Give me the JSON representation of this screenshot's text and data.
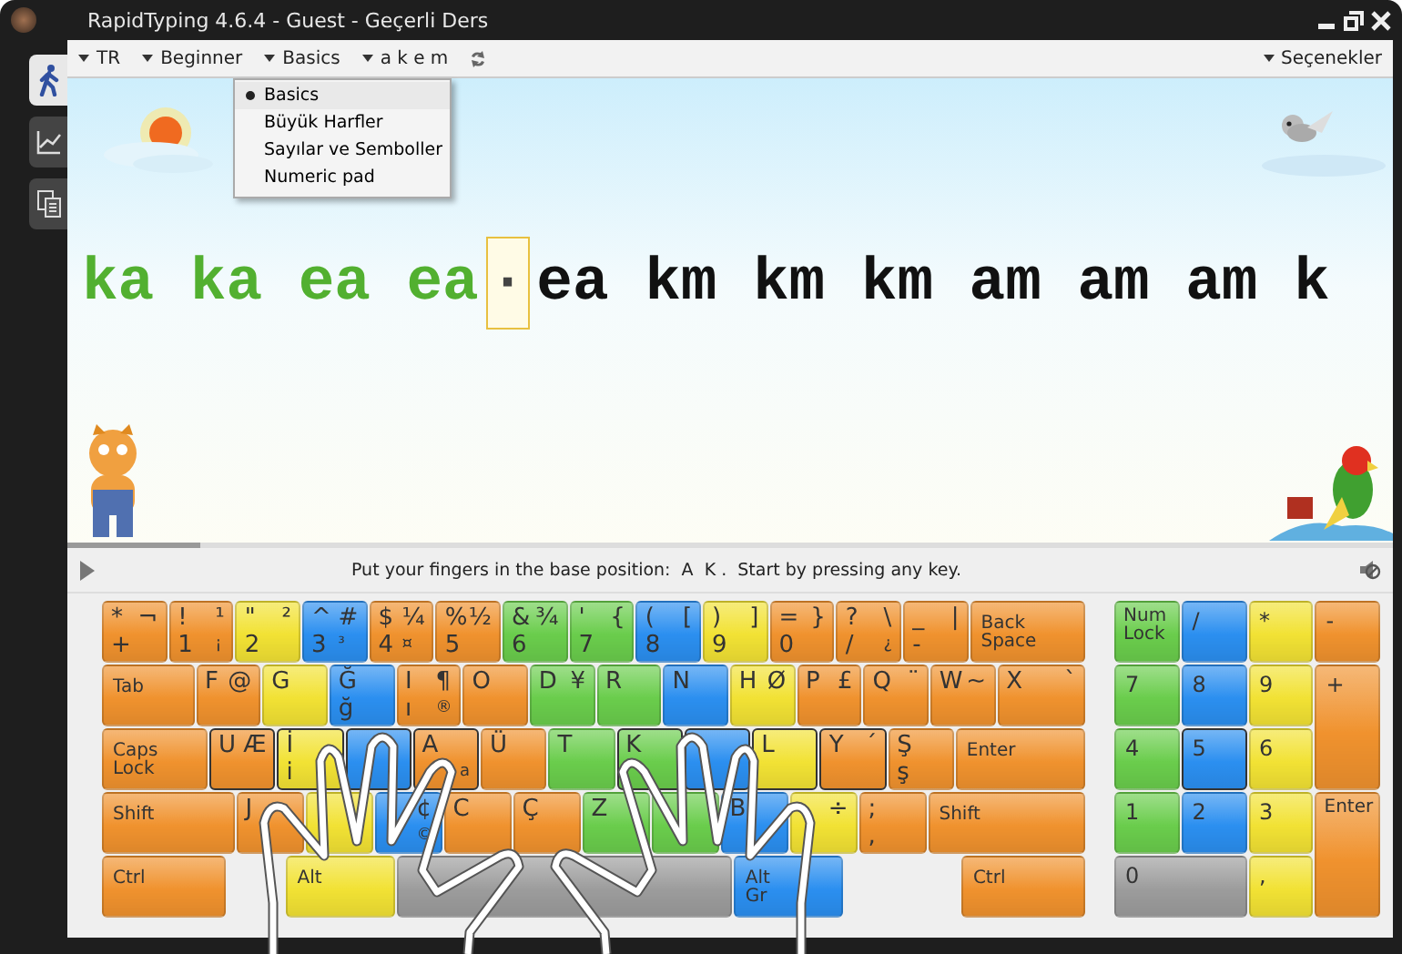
{
  "window": {
    "title": "RapidTyping 4.6.4 - Guest - Geçerli Ders"
  },
  "sidebar": [
    {
      "kind": "walker",
      "selected": true
    },
    {
      "kind": "chart",
      "selected": false
    },
    {
      "kind": "docs",
      "selected": false
    }
  ],
  "menu": [
    {
      "label": "TR"
    },
    {
      "label": "Beginner"
    },
    {
      "label": "Basics"
    },
    {
      "label": "a k e m"
    }
  ],
  "options": {
    "label": "Seçenekler"
  },
  "dropdown": [
    {
      "label": "Basics",
      "selected": true
    },
    {
      "label": "Büyük Harfler",
      "selected": false
    },
    {
      "label": "Sayılar ve Semboller",
      "selected": false
    },
    {
      "label": "Numeric pad",
      "selected": false
    }
  ],
  "lesson": {
    "typed": "ka ka ea ea",
    "cursor": "·",
    "pending": "ea km km km am am am k"
  },
  "progress": {
    "level": 0.1
  },
  "status": {
    "message": "Put your fingers in the base position:  A  K .  Start by pressing any key."
  },
  "keyboard": {
    "rows": [
      {
        "keys": [
          {
            "tl": "*",
            "tr": "¬",
            "bl": "+",
            "color": "#f0922e",
            "home": false
          },
          {
            "tl": "!",
            "tr": "¹",
            "bl": "1",
            "br": "¡",
            "color": "#f0922e",
            "home": false
          },
          {
            "tl": "\"",
            "tr": "²",
            "bl": "2",
            "color": "#f2e234",
            "home": false
          },
          {
            "tl": "^",
            "tr": "#",
            "bl": "3",
            "br": "³",
            "color": "#2b8ff0",
            "home": false
          },
          {
            "tl": "$",
            "tr": "¼",
            "bl": "4",
            "br": "¤",
            "color": "#f0922e",
            "home": false
          },
          {
            "tl": "%",
            "tr": "½",
            "bl": "5",
            "color": "#f0922e",
            "home": false
          },
          {
            "tl": "&",
            "tr": "¾",
            "bl": "6",
            "color": "#6acd4c",
            "home": false
          },
          {
            "tl": "'",
            "tr": "{",
            "bl": "7",
            "color": "#6acd4c",
            "home": false
          },
          {
            "tl": "(",
            "tr": "[",
            "bl": "8",
            "color": "#2b8ff0",
            "home": false
          },
          {
            "tl": ")",
            "tr": "]",
            "bl": "9",
            "color": "#f2e234",
            "home": false
          },
          {
            "tl": "=",
            "tr": "}",
            "bl": "0",
            "color": "#f0922e",
            "home": false
          },
          {
            "tl": "?",
            "tr": "\\",
            "bl": "/",
            "br": "¿",
            "color": "#f0922e",
            "home": false
          },
          {
            "tl": "_",
            "tr": "|",
            "bl": "-",
            "color": "#f0922e",
            "home": false
          },
          {
            "label": "Back Space",
            "color": "#f0922e",
            "home": false
          }
        ]
      },
      {
        "keys": [
          {
            "label": "Tab",
            "color": "#f0922e",
            "home": false
          },
          {
            "tl": "F",
            "tr": "@",
            "color": "#f0922e",
            "home": false
          },
          {
            "tl": "G",
            "color": "#f2e234",
            "home": false
          },
          {
            "tl": "Ğ",
            "bl": "ğ",
            "color": "#2b8ff0",
            "home": false
          },
          {
            "tl": "I",
            "tr": "¶",
            "bl": "ı",
            "br": "®",
            "color": "#f0922e",
            "home": false
          },
          {
            "tl": "O",
            "color": "#f0922e",
            "home": false
          },
          {
            "tl": "D",
            "tr": "¥",
            "color": "#6acd4c",
            "home": false
          },
          {
            "tl": "R",
            "color": "#6acd4c",
            "home": false
          },
          {
            "tl": "N",
            "color": "#2b8ff0",
            "home": false
          },
          {
            "tl": "H",
            "tr": "Ø",
            "color": "#f2e234",
            "home": false
          },
          {
            "tl": "P",
            "tr": "£",
            "color": "#f0922e",
            "home": false
          },
          {
            "tl": "Q",
            "tr": "¨",
            "color": "#f0922e",
            "home": false
          },
          {
            "tl": "W",
            "tr": "~",
            "color": "#f0922e",
            "home": false
          },
          {
            "tl": "X",
            "tr": "`",
            "color": "#f0922e",
            "home": false
          }
        ]
      },
      {
        "keys": [
          {
            "label": "Caps Lock",
            "color": "#f0922e",
            "home": false
          },
          {
            "tl": "U",
            "tr": "Æ",
            "color": "#f0922e",
            "home": true
          },
          {
            "tl": "İ",
            "bl": "i",
            "color": "#f2e234",
            "home": true
          },
          {
            "color": "#2b8ff0",
            "home": true
          },
          {
            "tl": "A",
            "br": "a",
            "color": "#f0922e",
            "home": true
          },
          {
            "tl": "Ü",
            "color": "#f0922e",
            "home": false
          },
          {
            "tl": "T",
            "color": "#6acd4c",
            "home": false
          },
          {
            "tl": "K",
            "color": "#6acd4c",
            "home": true
          },
          {
            "color": "#2b8ff0",
            "home": true
          },
          {
            "tl": "L",
            "color": "#f2e234",
            "home": true
          },
          {
            "tl": "Y",
            "tr": "´",
            "color": "#f0922e",
            "home": true
          },
          {
            "tl": "Ş",
            "bl": "ş",
            "color": "#f0922e",
            "home": false
          },
          {
            "label": "Enter",
            "color": "#f0922e",
            "home": false
          }
        ]
      },
      {
        "keys": [
          {
            "label": "Shift",
            "color": "#f0922e",
            "home": false
          },
          {
            "tl": "J",
            "color": "#f0922e",
            "home": false
          },
          {
            "color": "#f2e234",
            "home": false
          },
          {
            "tr": "¢",
            "br": "©",
            "color": "#2b8ff0",
            "home": false
          },
          {
            "tl": "C",
            "color": "#f0922e",
            "home": false
          },
          {
            "tl": "Ç",
            "color": "#f0922e",
            "home": false
          },
          {
            "tl": "Z",
            "color": "#6acd4c",
            "home": false
          },
          {
            "color": "#6acd4c",
            "home": false
          },
          {
            "tl": "B",
            "color": "#2b8ff0",
            "home": false
          },
          {
            "tr": "÷",
            "color": "#f2e234",
            "home": false
          },
          {
            "tl": ";",
            "bl": ",",
            "color": "#f0922e",
            "home": false
          },
          {
            "label": "Shift",
            "color": "#f0922e",
            "home": false
          }
        ]
      },
      {
        "keys": [
          {
            "label": "Ctrl",
            "color": "#f0922e",
            "home": false
          },
          {
            "label": "Alt",
            "color": "#f2e234",
            "home": false
          },
          {
            "color": "#9c9c9c",
            "home": false
          },
          {
            "label": "Alt Gr",
            "color": "#2b8ff0",
            "home": false
          },
          {
            "label": "Ctrl",
            "color": "#f0922e",
            "home": false
          }
        ]
      }
    ]
  },
  "numpad": [
    {
      "label": "Num Lock",
      "color": "#6acd4c",
      "home": false
    },
    {
      "label": "/",
      "color": "#2b8ff0",
      "home": false
    },
    {
      "label": "*",
      "color": "#f2e234",
      "home": false
    },
    {
      "label": "-",
      "color": "#f0922e",
      "home": false
    },
    {
      "label": "7",
      "color": "#6acd4c",
      "home": false
    },
    {
      "label": "8",
      "color": "#2b8ff0",
      "home": false
    },
    {
      "label": "9",
      "color": "#f2e234",
      "home": false
    },
    {
      "label": "+",
      "color": "#f0922e",
      "home": false
    },
    {
      "label": "4",
      "color": "#6acd4c",
      "home": false
    },
    {
      "label": "5",
      "color": "#2b8ff0",
      "home": true
    },
    {
      "label": "6",
      "color": "#f2e234",
      "home": false
    },
    {
      "label": "1",
      "color": "#6acd4c",
      "home": false
    },
    {
      "label": "2",
      "color": "#2b8ff0",
      "home": false
    },
    {
      "label": "3",
      "color": "#f2e234",
      "home": false
    },
    {
      "label": "Enter",
      "color": "#f0922e",
      "home": false
    },
    {
      "label": "0",
      "color": "#9c9c9c",
      "home": false
    },
    {
      "label": ",",
      "color": "#f2e234",
      "home": false
    }
  ]
}
